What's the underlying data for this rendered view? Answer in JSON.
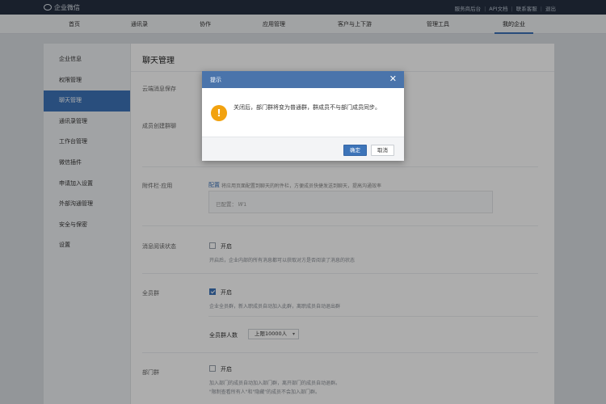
{
  "topbar": {
    "brand": "企业微信",
    "links": [
      "服务商后台",
      "API文档",
      "联系客服",
      "退出"
    ]
  },
  "nav": [
    "首页",
    "通讯录",
    "协作",
    "应用管理",
    "客户与上下游",
    "管理工具",
    "我的企业"
  ],
  "sidebar": [
    "企业信息",
    "权限管理",
    "聊天管理",
    "通讯录管理",
    "工作台管理",
    "微信插件",
    "申请加入设置",
    "外部沟通管理",
    "安全与保密",
    "设置"
  ],
  "content": {
    "title": "聊天管理",
    "cloud_label": "云端消息保存",
    "member_create_label": "成员创建群聊",
    "attach_label": "附件栏·应用",
    "attach_config_link": "配置",
    "attach_config_desc": "将应用页面配置到聊天的附件栏，方便成员快捷发送到聊天，提高沟通效率",
    "attach_configured": "已配置： 𝑊1",
    "read_label": "消息阅读状态",
    "read_option": "开启",
    "read_desc": "开启后，企业内部的所有消息都可以获取对方是否阅读了消息的状态",
    "allstaff_label": "全员群",
    "allstaff_option": "开启",
    "allstaff_desc": "企业全员群，新入职成员自动加入此群，离职成员自动退出群",
    "allstaff_count_label": "全员群人数",
    "allstaff_count_value": "上限10000人",
    "dept_label": "部门群",
    "dept_option": "开启",
    "dept_desc1": "加入部门的成员自动加入部门群，离开部门的成员自动退群。",
    "dept_desc2": "\"限制查看所有人\"和\"隐藏\"的成员不会加入部门群。"
  },
  "dialog": {
    "title": "提示",
    "close": "✕",
    "icon": "warning-icon",
    "message": "关闭后，部门群将变为普通群，群成员不与部门成员同步。",
    "ok": "确定",
    "cancel": "取消"
  }
}
